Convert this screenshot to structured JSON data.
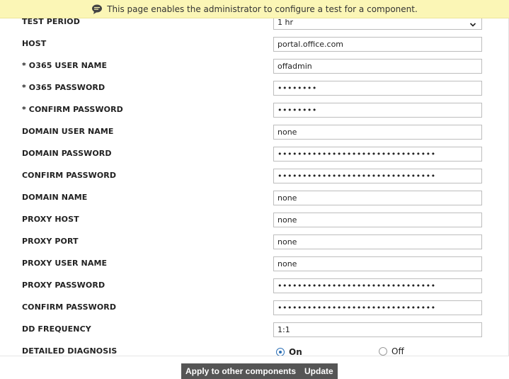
{
  "banner": {
    "text": "This page enables the administrator to configure a test for a component."
  },
  "form": {
    "test_period": {
      "label": "TEST PERIOD",
      "value": "1 hr"
    },
    "host": {
      "label": "HOST",
      "value": "portal.office.com"
    },
    "o365_user": {
      "label": "* O365 USER NAME",
      "value": "offadmin"
    },
    "o365_password": {
      "label": "* O365 PASSWORD",
      "value": "••••••••"
    },
    "confirm_password_1": {
      "label": "* CONFIRM PASSWORD",
      "value": "••••••••"
    },
    "domain_user": {
      "label": "DOMAIN USER NAME",
      "value": "none"
    },
    "domain_password": {
      "label": "DOMAIN PASSWORD",
      "value": "••••••••••••••••••••••••••••••••"
    },
    "confirm_password_2": {
      "label": "CONFIRM PASSWORD",
      "value": "••••••••••••••••••••••••••••••••"
    },
    "domain_name": {
      "label": "DOMAIN NAME",
      "value": "none"
    },
    "proxy_host": {
      "label": "PROXY HOST",
      "value": "none"
    },
    "proxy_port": {
      "label": "PROXY PORT",
      "value": "none"
    },
    "proxy_user": {
      "label": "PROXY USER NAME",
      "value": "none"
    },
    "proxy_password": {
      "label": "PROXY PASSWORD",
      "value": "••••••••••••••••••••••••••••••••"
    },
    "confirm_password_3": {
      "label": "CONFIRM PASSWORD",
      "value": "••••••••••••••••••••••••••••••••"
    },
    "dd_frequency": {
      "label": "DD FREQUENCY",
      "value": "1:1"
    },
    "detailed_diagnosis": {
      "label": "DETAILED DIAGNOSIS",
      "on_label": "On",
      "off_label": "Off",
      "selected": "On"
    }
  },
  "footer": {
    "apply_label": "Apply to other components",
    "update_label": "Update"
  },
  "colors": {
    "banner_bg": "#fbf6b6",
    "button_bg": "#555555",
    "radio_accent": "#2b6fb6"
  }
}
